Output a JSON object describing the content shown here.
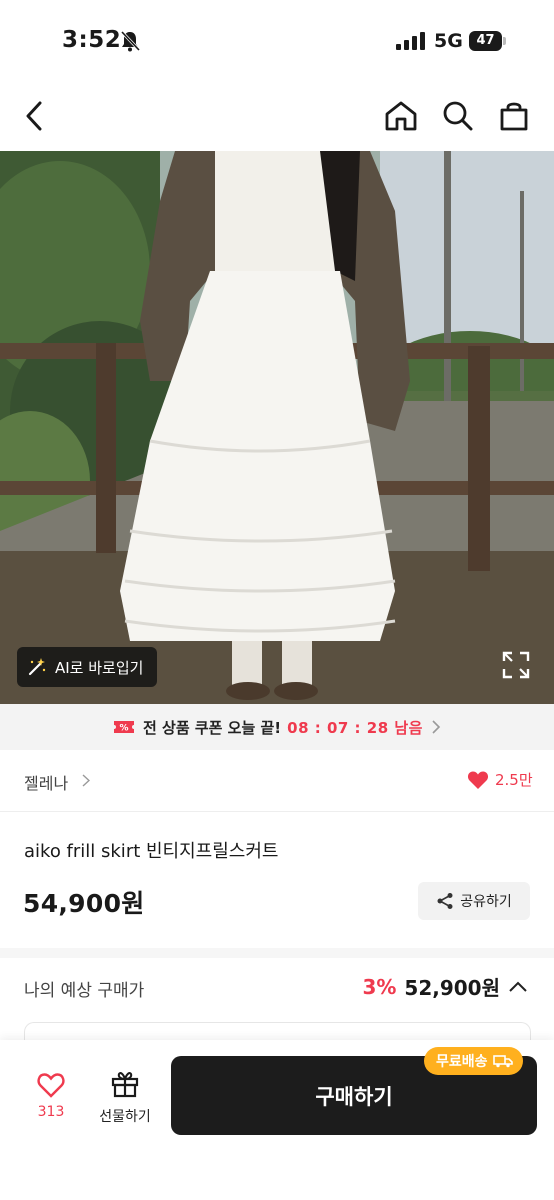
{
  "status_bar": {
    "time": "3:52",
    "network": "5G",
    "battery": "47"
  },
  "nav": {
    "back": "back-icon",
    "home": "home-icon",
    "search": "search-icon",
    "cart": "cart-icon"
  },
  "image": {
    "ai_button_label": "AI로 바로입기"
  },
  "coupon": {
    "text": "전 상품 쿠폰 오늘 끝!",
    "timer": "08 : 07 : 28 남음"
  },
  "brand": {
    "name": "젤레나",
    "likes": "2.5만"
  },
  "product": {
    "title": "aiko frill skirt 빈티지프릴스커트",
    "price": "54,900원",
    "share_label": "공유하기"
  },
  "expected": {
    "label": "나의 예상 구매가",
    "discount": "3%",
    "price": "52,900원"
  },
  "bottom": {
    "like_count": "313",
    "gift_label": "선물하기",
    "buy_label": "구매하기",
    "shipping_badge": "무료배송"
  },
  "colors": {
    "accent": "#ef3a4e",
    "badge": "#ffb01e",
    "buy_button": "#1c1c1c"
  }
}
